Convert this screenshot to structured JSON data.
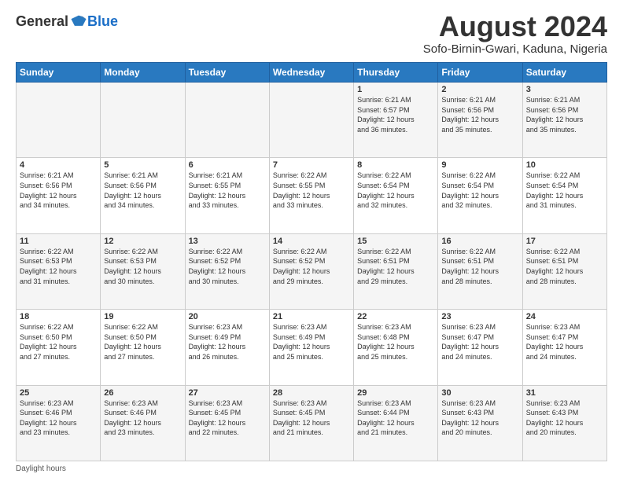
{
  "header": {
    "logo_general": "General",
    "logo_blue": "Blue",
    "month_title": "August 2024",
    "location": "Sofo-Birnin-Gwari, Kaduna, Nigeria"
  },
  "days_of_week": [
    "Sunday",
    "Monday",
    "Tuesday",
    "Wednesday",
    "Thursday",
    "Friday",
    "Saturday"
  ],
  "weeks": [
    [
      {
        "day": "",
        "info": ""
      },
      {
        "day": "",
        "info": ""
      },
      {
        "day": "",
        "info": ""
      },
      {
        "day": "",
        "info": ""
      },
      {
        "day": "1",
        "info": "Sunrise: 6:21 AM\nSunset: 6:57 PM\nDaylight: 12 hours\nand 36 minutes."
      },
      {
        "day": "2",
        "info": "Sunrise: 6:21 AM\nSunset: 6:56 PM\nDaylight: 12 hours\nand 35 minutes."
      },
      {
        "day": "3",
        "info": "Sunrise: 6:21 AM\nSunset: 6:56 PM\nDaylight: 12 hours\nand 35 minutes."
      }
    ],
    [
      {
        "day": "4",
        "info": "Sunrise: 6:21 AM\nSunset: 6:56 PM\nDaylight: 12 hours\nand 34 minutes."
      },
      {
        "day": "5",
        "info": "Sunrise: 6:21 AM\nSunset: 6:56 PM\nDaylight: 12 hours\nand 34 minutes."
      },
      {
        "day": "6",
        "info": "Sunrise: 6:21 AM\nSunset: 6:55 PM\nDaylight: 12 hours\nand 33 minutes."
      },
      {
        "day": "7",
        "info": "Sunrise: 6:22 AM\nSunset: 6:55 PM\nDaylight: 12 hours\nand 33 minutes."
      },
      {
        "day": "8",
        "info": "Sunrise: 6:22 AM\nSunset: 6:54 PM\nDaylight: 12 hours\nand 32 minutes."
      },
      {
        "day": "9",
        "info": "Sunrise: 6:22 AM\nSunset: 6:54 PM\nDaylight: 12 hours\nand 32 minutes."
      },
      {
        "day": "10",
        "info": "Sunrise: 6:22 AM\nSunset: 6:54 PM\nDaylight: 12 hours\nand 31 minutes."
      }
    ],
    [
      {
        "day": "11",
        "info": "Sunrise: 6:22 AM\nSunset: 6:53 PM\nDaylight: 12 hours\nand 31 minutes."
      },
      {
        "day": "12",
        "info": "Sunrise: 6:22 AM\nSunset: 6:53 PM\nDaylight: 12 hours\nand 30 minutes."
      },
      {
        "day": "13",
        "info": "Sunrise: 6:22 AM\nSunset: 6:52 PM\nDaylight: 12 hours\nand 30 minutes."
      },
      {
        "day": "14",
        "info": "Sunrise: 6:22 AM\nSunset: 6:52 PM\nDaylight: 12 hours\nand 29 minutes."
      },
      {
        "day": "15",
        "info": "Sunrise: 6:22 AM\nSunset: 6:51 PM\nDaylight: 12 hours\nand 29 minutes."
      },
      {
        "day": "16",
        "info": "Sunrise: 6:22 AM\nSunset: 6:51 PM\nDaylight: 12 hours\nand 28 minutes."
      },
      {
        "day": "17",
        "info": "Sunrise: 6:22 AM\nSunset: 6:51 PM\nDaylight: 12 hours\nand 28 minutes."
      }
    ],
    [
      {
        "day": "18",
        "info": "Sunrise: 6:22 AM\nSunset: 6:50 PM\nDaylight: 12 hours\nand 27 minutes."
      },
      {
        "day": "19",
        "info": "Sunrise: 6:22 AM\nSunset: 6:50 PM\nDaylight: 12 hours\nand 27 minutes."
      },
      {
        "day": "20",
        "info": "Sunrise: 6:23 AM\nSunset: 6:49 PM\nDaylight: 12 hours\nand 26 minutes."
      },
      {
        "day": "21",
        "info": "Sunrise: 6:23 AM\nSunset: 6:49 PM\nDaylight: 12 hours\nand 25 minutes."
      },
      {
        "day": "22",
        "info": "Sunrise: 6:23 AM\nSunset: 6:48 PM\nDaylight: 12 hours\nand 25 minutes."
      },
      {
        "day": "23",
        "info": "Sunrise: 6:23 AM\nSunset: 6:47 PM\nDaylight: 12 hours\nand 24 minutes."
      },
      {
        "day": "24",
        "info": "Sunrise: 6:23 AM\nSunset: 6:47 PM\nDaylight: 12 hours\nand 24 minutes."
      }
    ],
    [
      {
        "day": "25",
        "info": "Sunrise: 6:23 AM\nSunset: 6:46 PM\nDaylight: 12 hours\nand 23 minutes."
      },
      {
        "day": "26",
        "info": "Sunrise: 6:23 AM\nSunset: 6:46 PM\nDaylight: 12 hours\nand 23 minutes."
      },
      {
        "day": "27",
        "info": "Sunrise: 6:23 AM\nSunset: 6:45 PM\nDaylight: 12 hours\nand 22 minutes."
      },
      {
        "day": "28",
        "info": "Sunrise: 6:23 AM\nSunset: 6:45 PM\nDaylight: 12 hours\nand 21 minutes."
      },
      {
        "day": "29",
        "info": "Sunrise: 6:23 AM\nSunset: 6:44 PM\nDaylight: 12 hours\nand 21 minutes."
      },
      {
        "day": "30",
        "info": "Sunrise: 6:23 AM\nSunset: 6:43 PM\nDaylight: 12 hours\nand 20 minutes."
      },
      {
        "day": "31",
        "info": "Sunrise: 6:23 AM\nSunset: 6:43 PM\nDaylight: 12 hours\nand 20 minutes."
      }
    ]
  ],
  "footer": {
    "text": "Daylight hours"
  }
}
